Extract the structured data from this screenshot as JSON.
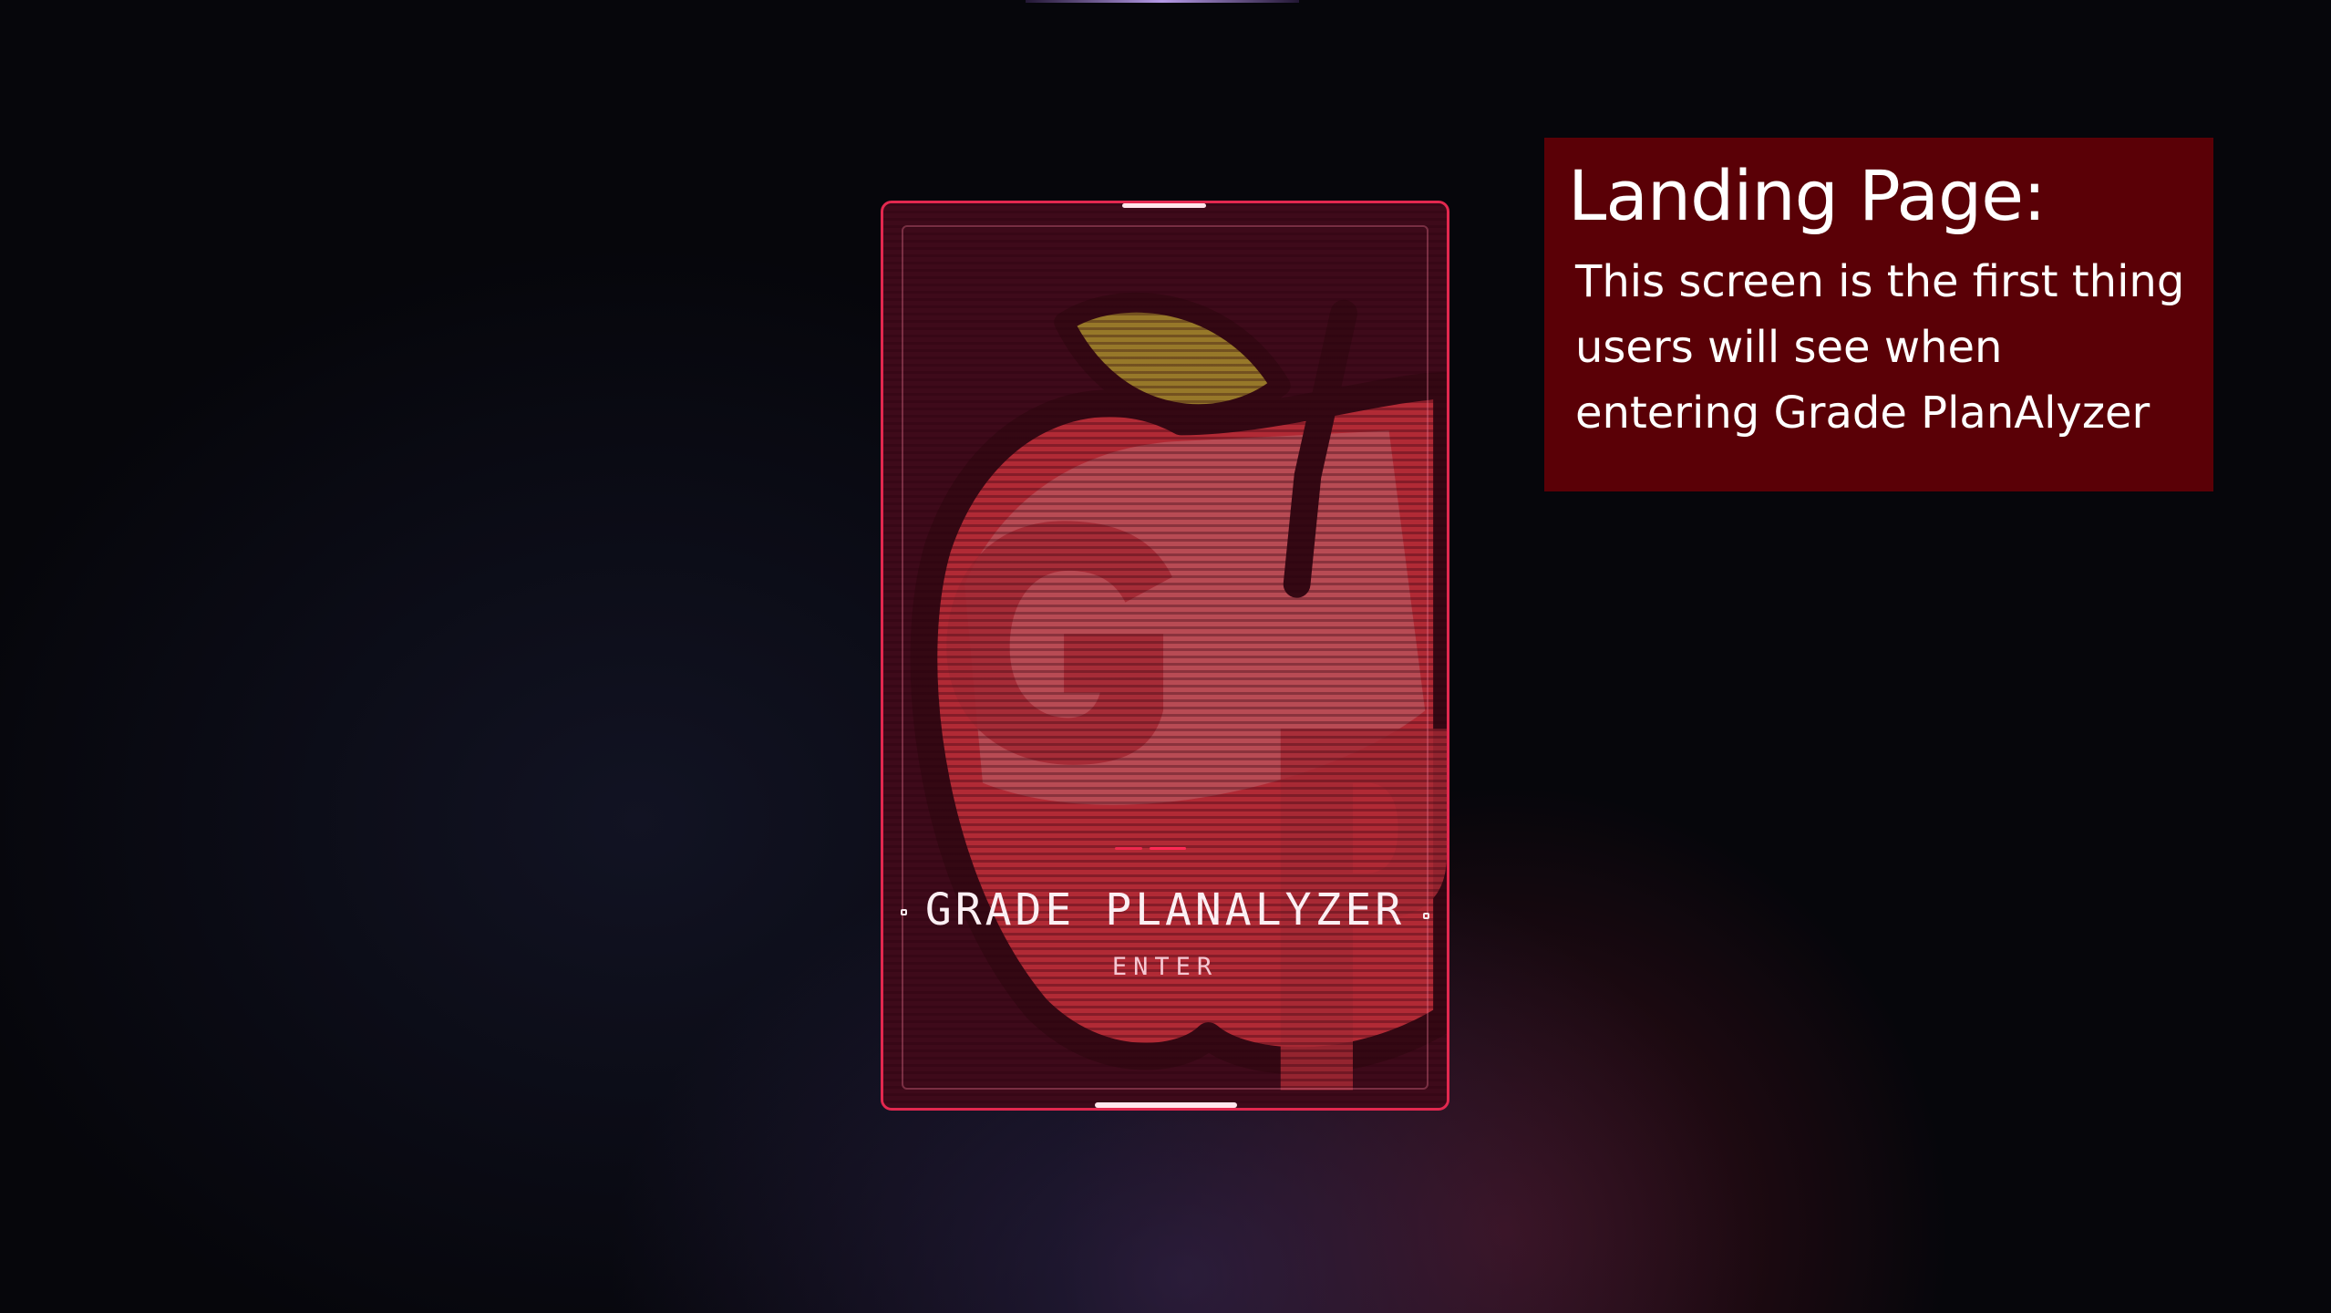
{
  "landing": {
    "app_title": "GRADE PLANALYZER",
    "enter_label": "ENTER",
    "logo_icon": "apple-gp-logo-icon"
  },
  "annotation": {
    "title": "Landing Page:",
    "body": "This screen is the first thing users will see when entering Grade PlanAlyzer"
  },
  "colors": {
    "card_border": "#e3284f",
    "apple_red": "#e03a44",
    "leaf": "#b4a32f",
    "annotation_bg": "#5a0006"
  }
}
